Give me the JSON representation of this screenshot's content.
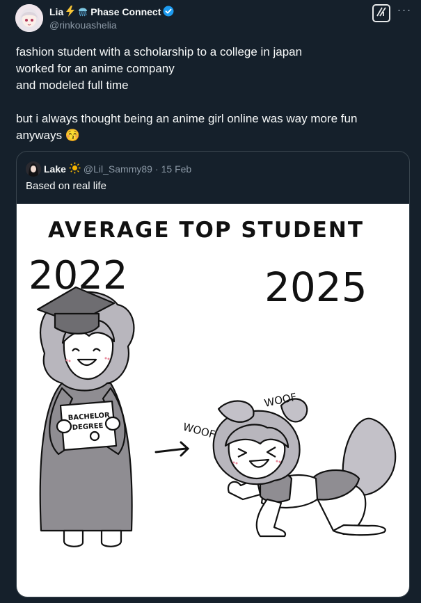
{
  "author": {
    "display_name": "Lia",
    "affiliation": "Phase Connect",
    "handle": "@rinkouashelia"
  },
  "tweet": {
    "lines": [
      "fashion student with a scholarship to a college in japan",
      "worked for an anime company",
      "and modeled full time"
    ],
    "lines2": [
      "but i always thought being an anime girl online was way more fun",
      "anyways 😚"
    ]
  },
  "quoted": {
    "display_name": "Lake",
    "handle": "@Lil_Sammy89",
    "separator": "·",
    "date": "15 Feb",
    "text": "Based on real life"
  },
  "comic": {
    "title": "AVERAGE TOP STUDENT",
    "left_year": "2022",
    "right_year": "2025",
    "sign_line1": "BACHELOR",
    "sign_line2": "DEGREE",
    "woof1": "WOOF",
    "woof2": "WOOF"
  },
  "icons": {
    "lightning": "lightning-icon",
    "jellyfish": "jellyfish-icon",
    "verified": "verified-badge-icon",
    "grok": "grok-icon",
    "more": "more-icon",
    "sun": "sun-icon"
  },
  "colors": {
    "background": "#15202b",
    "verified": "#1d9bf0",
    "muted": "#8b98a5",
    "border": "#38444d"
  }
}
